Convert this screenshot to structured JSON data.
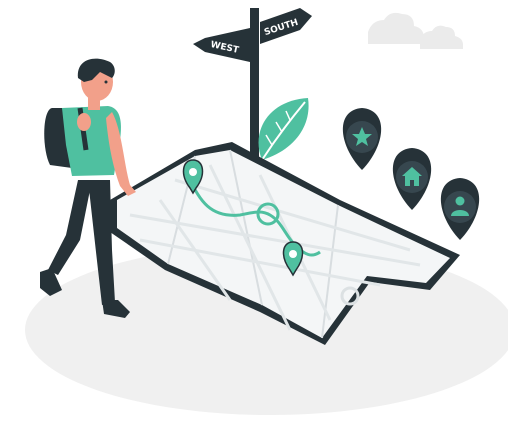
{
  "signpost": {
    "west_label": "WEST",
    "south_label": "SOUTH"
  },
  "colors": {
    "accent": "#4FC0A0",
    "dark": "#263238",
    "ground": "#F0F0F0",
    "map": "#F4F6F7",
    "skin": "#F2A08A"
  },
  "icons": {
    "pins": [
      "star-icon",
      "home-icon",
      "user-icon"
    ]
  }
}
